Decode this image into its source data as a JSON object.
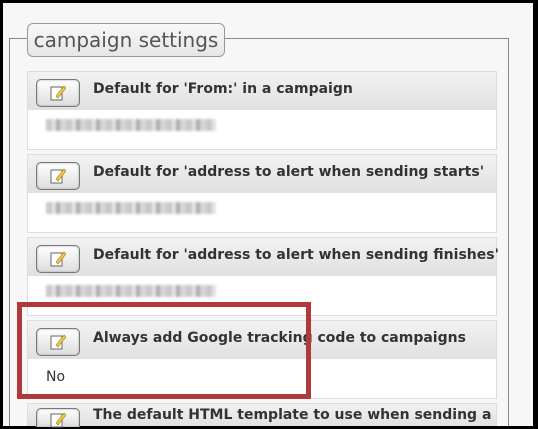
{
  "fieldset": {
    "legend": "campaign settings"
  },
  "settings": [
    {
      "title": "Default for 'From:' in a campaign",
      "value": null
    },
    {
      "title": "Default for 'address to alert when sending starts'",
      "value": null
    },
    {
      "title": "Default for 'address to alert when sending finishes'",
      "value": null
    },
    {
      "title": "Always add Google tracking code to campaigns",
      "value": "No"
    },
    {
      "title": "The default HTML template to use when sending a",
      "value": null
    }
  ],
  "colors": {
    "highlight": "#b0393b"
  }
}
